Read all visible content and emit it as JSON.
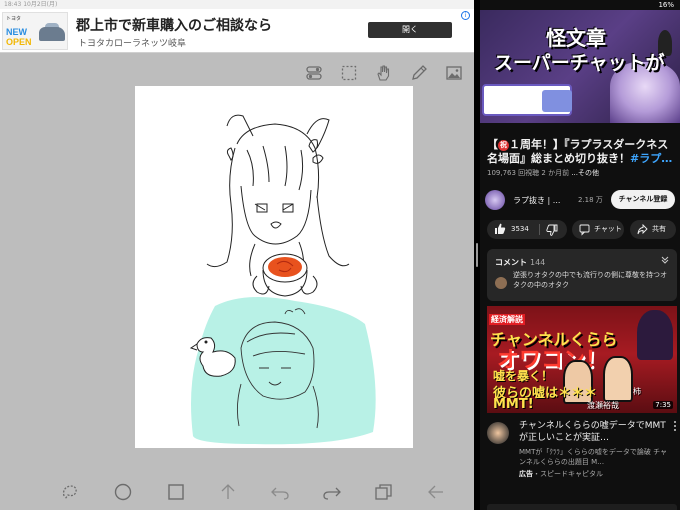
{
  "left_app": {
    "status_text": "18:43  10月2日(月)",
    "ad": {
      "thumb_brand": "トヨタ",
      "thumb_new": "NEW",
      "thumb_open": "OPEN",
      "title": "郡上市で新車購入のご相談なら",
      "subtitle": "トヨタカローラネッツ岐阜",
      "open_label": "開く",
      "info_glyph": "i"
    },
    "top_tools": [
      "toggle-icon",
      "select-icon",
      "hand-icon",
      "pen-icon",
      "image-icon"
    ],
    "bottom_tools": [
      "lasso-icon",
      "circle-icon",
      "square-icon",
      "arrow-up-icon",
      "undo-icon",
      "redo-icon",
      "layers-icon",
      "back-icon"
    ],
    "sketch": {
      "hair_color": "#222222",
      "tint_color": "#b8f1e6",
      "cup_color": "#e8521e"
    }
  },
  "right_app": {
    "status": {
      "battery": "16%"
    },
    "player": {
      "overlay_line1": "怪文章",
      "overlay_line2": "スーパーチャットが"
    },
    "video": {
      "title_prefix": "【",
      "title_badge": "祝",
      "title_main": "１周年！】『ラプラスダークネス名場面』総まとめ切り抜き！",
      "title_tag": "#ラプ…",
      "views": "109,763 回視聴",
      "age": "2 か月前",
      "more": "...その他"
    },
    "channel": {
      "name": "ラプ抜き | ...",
      "subs": "2.18 万",
      "subscribe_label": "チャンネル登録"
    },
    "actions": {
      "likes": "3534",
      "chat_label": "チャット",
      "share_label": "共有"
    },
    "comments": {
      "label": "コメント",
      "count": "144",
      "top_comment": "逆張りオタクの中でも流行りの側に尊敬を持つオタクの中のオタク"
    },
    "recommended": {
      "tag": "経済解説",
      "line1": "チャンネルくらら",
      "line2": "オワコン！",
      "line3": "嘘を暴く！",
      "line4": "彼らの嘘は＊＊＊",
      "line5": "MMT!",
      "name1": "渡瀬裕哉",
      "name2": "柿",
      "duration": "7:35",
      "title": "チャンネルくららの嘘データでMMTが正しいことが実証…",
      "description": "MMTが「ｸﾗﾗ」くららの嘘をデータで論破 チャンネルくららの出題目 M…",
      "ad_label": "広告",
      "advertiser": "・スピードキャピタル"
    }
  }
}
